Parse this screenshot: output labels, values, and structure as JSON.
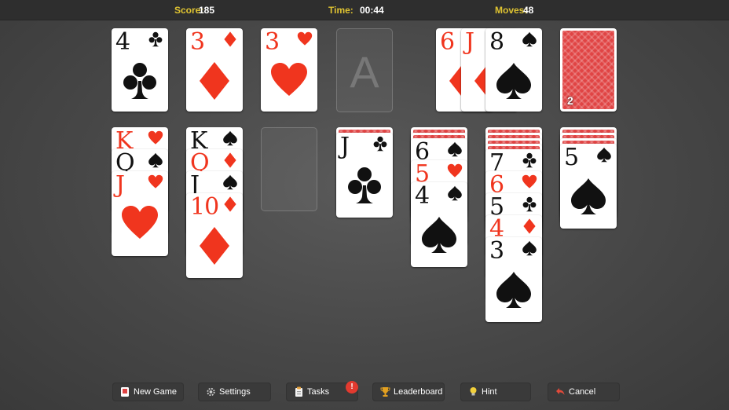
{
  "header": {
    "score_label": "Score:",
    "score_value": "185",
    "time_label": "Time:",
    "time_value": "00:44",
    "moves_label": "Moves:",
    "moves_value": "48"
  },
  "foundations": [
    {
      "rank": "4",
      "suit": "clubs",
      "color": "black"
    },
    {
      "rank": "3",
      "suit": "diamonds",
      "color": "red"
    },
    {
      "rank": "3",
      "suit": "hearts",
      "color": "red"
    },
    {
      "placeholder": "A"
    }
  ],
  "waste": [
    {
      "rank": "6",
      "suit": "diamonds",
      "color": "red"
    },
    {
      "rank": "J",
      "suit": "diamonds",
      "color": "red"
    },
    {
      "rank": "8",
      "suit": "spades",
      "color": "black"
    }
  ],
  "stock": {
    "count": "2"
  },
  "tableau": [
    {
      "hidden": 0,
      "cards": [
        {
          "rank": "K",
          "suit": "hearts"
        },
        {
          "rank": "Q",
          "suit": "spades"
        },
        {
          "rank": "J",
          "suit": "hearts"
        }
      ]
    },
    {
      "hidden": 0,
      "cards": [
        {
          "rank": "K",
          "suit": "spades"
        },
        {
          "rank": "Q",
          "suit": "diamonds"
        },
        {
          "rank": "J",
          "suit": "spades"
        },
        {
          "rank": "10",
          "suit": "diamonds"
        }
      ]
    },
    {
      "hidden": 0,
      "cards": []
    },
    {
      "hidden": 1,
      "cards": [
        {
          "rank": "J",
          "suit": "clubs"
        }
      ]
    },
    {
      "hidden": 2,
      "cards": [
        {
          "rank": "6",
          "suit": "spades"
        },
        {
          "rank": "5",
          "suit": "hearts"
        },
        {
          "rank": "4",
          "suit": "spades"
        }
      ]
    },
    {
      "hidden": 4,
      "cards": [
        {
          "rank": "7",
          "suit": "clubs"
        },
        {
          "rank": "6",
          "suit": "hearts"
        },
        {
          "rank": "5",
          "suit": "clubs"
        },
        {
          "rank": "4",
          "suit": "diamonds"
        },
        {
          "rank": "3",
          "suit": "spades"
        }
      ]
    },
    {
      "hidden": 3,
      "cards": [
        {
          "rank": "5",
          "suit": "spades"
        }
      ]
    }
  ],
  "toolbar": {
    "new_game": "New Game",
    "settings": "Settings",
    "tasks": "Tasks",
    "tasks_badge": "!",
    "leaderboard": "Leaderboard",
    "hint": "Hint",
    "cancel": "Cancel"
  },
  "colors": {
    "red_suit": "#f0351e",
    "black_suit": "#111111",
    "header_label": "#e0c431",
    "card_back": "#e04444"
  },
  "icons": {
    "new_game": "cards-icon",
    "settings": "gear-icon",
    "tasks": "clipboard-icon",
    "leaderboard": "trophy-icon",
    "hint": "lightbulb-icon",
    "cancel": "undo-arrow-icon"
  }
}
